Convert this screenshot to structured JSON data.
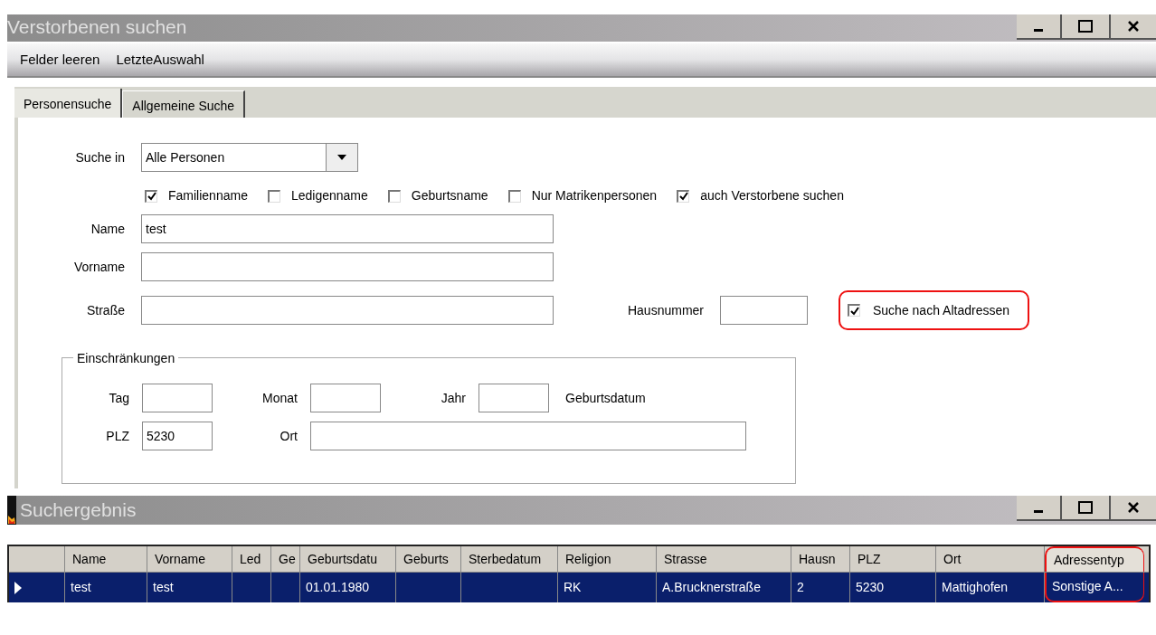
{
  "window": {
    "title": "Verstorbenen suchen"
  },
  "menu": [
    {
      "label": "Felder leeren"
    },
    {
      "label": "LetzteAuswahl"
    }
  ],
  "tabs": [
    {
      "label": "Personensuche",
      "selected": true
    },
    {
      "label": "Allgemeine Suche",
      "selected": false
    }
  ],
  "search_in": {
    "label": "Suche in",
    "value": "Alle Personen"
  },
  "options": [
    {
      "label": "Familienname",
      "checked": true
    },
    {
      "label": "Ledigenname",
      "checked": false
    },
    {
      "label": "Geburtsname",
      "checked": false
    },
    {
      "label": "Nur Matrikenpersonen",
      "checked": false
    },
    {
      "label": "auch Verstorbene suchen",
      "checked": true
    }
  ],
  "name": {
    "label": "Name",
    "value": "test"
  },
  "vorname": {
    "label": "Vorname"
  },
  "strasse": {
    "label": "Straße"
  },
  "hausnummer": {
    "label": "Hausnummer"
  },
  "alt_addresses": {
    "label": "Suche nach Altadressen",
    "checked": true,
    "highlighted": true
  },
  "restrictions": {
    "title": "Einschränkungen",
    "tag": {
      "label": "Tag"
    },
    "monat": {
      "label": "Monat"
    },
    "jahr": {
      "label": "Jahr"
    },
    "birthdate_label": "Geburtsdatum",
    "plz": {
      "label": "PLZ",
      "value": "5230"
    },
    "ort": {
      "label": "Ort"
    }
  },
  "results": {
    "title": "Suchergebnis",
    "columns": [
      {
        "label": "Name",
        "highlighted": false
      },
      {
        "label": "Vorname",
        "highlighted": false
      },
      {
        "label": "Led",
        "highlighted": false
      },
      {
        "label": "Ge",
        "highlighted": false
      },
      {
        "label": "Geburtsdatu",
        "highlighted": false
      },
      {
        "label": "Geburts",
        "highlighted": false
      },
      {
        "label": "Sterbedatum",
        "highlighted": false
      },
      {
        "label": "Religion",
        "highlighted": false
      },
      {
        "label": "Strasse",
        "highlighted": false
      },
      {
        "label": "Hausn",
        "highlighted": false
      },
      {
        "label": "PLZ",
        "highlighted": false
      },
      {
        "label": "Ort",
        "highlighted": false
      },
      {
        "label": "Adressentyp",
        "highlighted": true
      }
    ],
    "rows": [
      {
        "selected": true,
        "cells": [
          "test",
          "test",
          null,
          null,
          "01.01.1980",
          null,
          null,
          "RK",
          "A.Brucknerstraße",
          "2",
          "5230",
          "Mattighofen",
          "Sonstige A..."
        ]
      }
    ]
  }
}
